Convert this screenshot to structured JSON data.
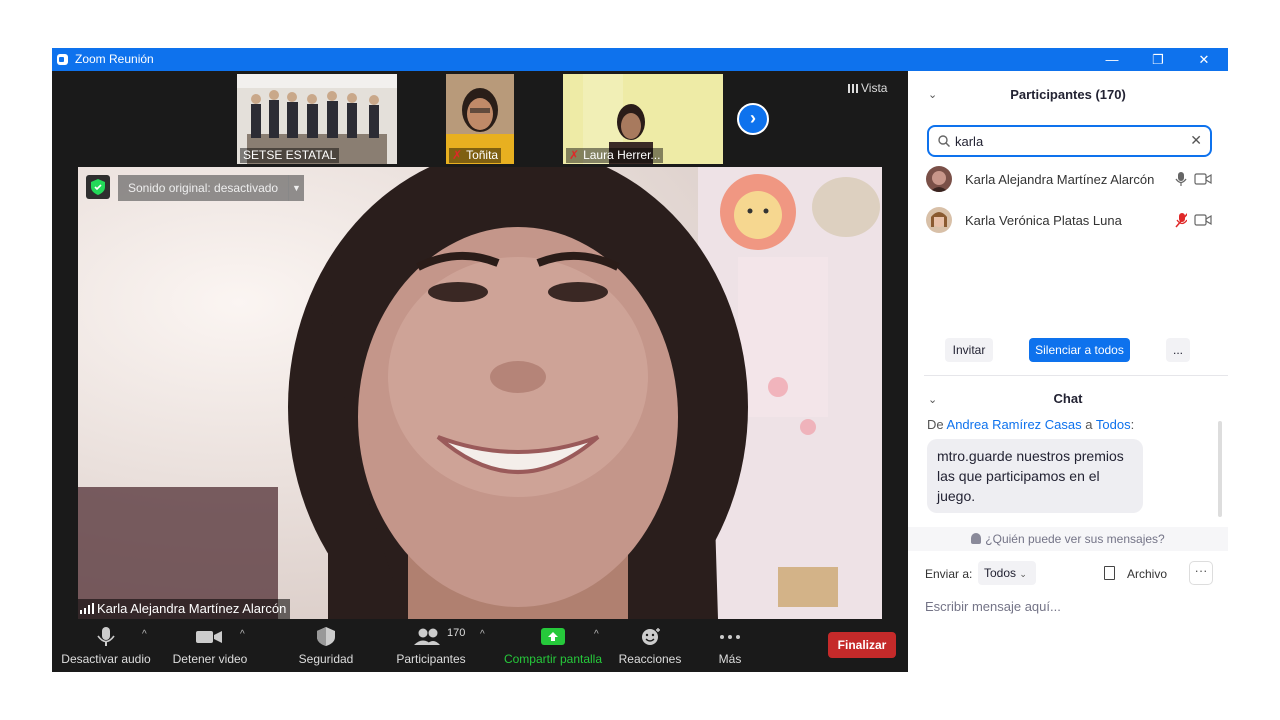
{
  "window": {
    "title": "Zoom Reunión",
    "minimize_label": "—",
    "restore_label": "❐",
    "close_label": "✕"
  },
  "meeting": {
    "view_label": "Vista",
    "thumbnails": [
      {
        "name": "SETSE ESTATAL",
        "muted": false
      },
      {
        "name": "Toñita",
        "muted": true
      },
      {
        "name": "Laura Herrer...",
        "muted": true
      }
    ],
    "next_icon": "chevron-right-icon",
    "original_sound_label": "Sonido original: desactivado",
    "active_speaker": "Karla Alejandra Martínez Alarcón"
  },
  "toolbar": {
    "mute_label": "Desactivar audio",
    "video_label": "Detener video",
    "security_label": "Seguridad",
    "participants_label": "Participantes",
    "participants_count": "170",
    "share_label": "Compartir pantalla",
    "reactions_label": "Reacciones",
    "more_label": "Más",
    "end_label": "Finalizar",
    "share_color": "#26c93b",
    "end_color": "#c52a2a"
  },
  "participants_panel": {
    "title": "Participantes (170)",
    "search_value": "karla",
    "participants": [
      {
        "name": "Karla Alejandra Martínez Alarcón",
        "mic": "on",
        "video": "off"
      },
      {
        "name": "Karla Verónica Platas Luna",
        "mic": "muted",
        "video": "off"
      }
    ],
    "invite_label": "Invitar",
    "mute_all_label": "Silenciar a todos",
    "more_label": "...",
    "accent_color": "#0e72ed"
  },
  "chat": {
    "title": "Chat",
    "from_prefix": "De",
    "from_name": "Andrea Ramírez Casas",
    "to_word": "a",
    "to_name": "Todos",
    "message": "mtro.guarde nuestros premios las que participamos en el juego.",
    "who_sees": "¿Quién puede ver sus mensajes?",
    "send_to_label": "Enviar a:",
    "send_to_value": "Todos",
    "file_label": "Archivo",
    "more_label": "···",
    "input_placeholder": "Escribir mensaje aquí..."
  }
}
